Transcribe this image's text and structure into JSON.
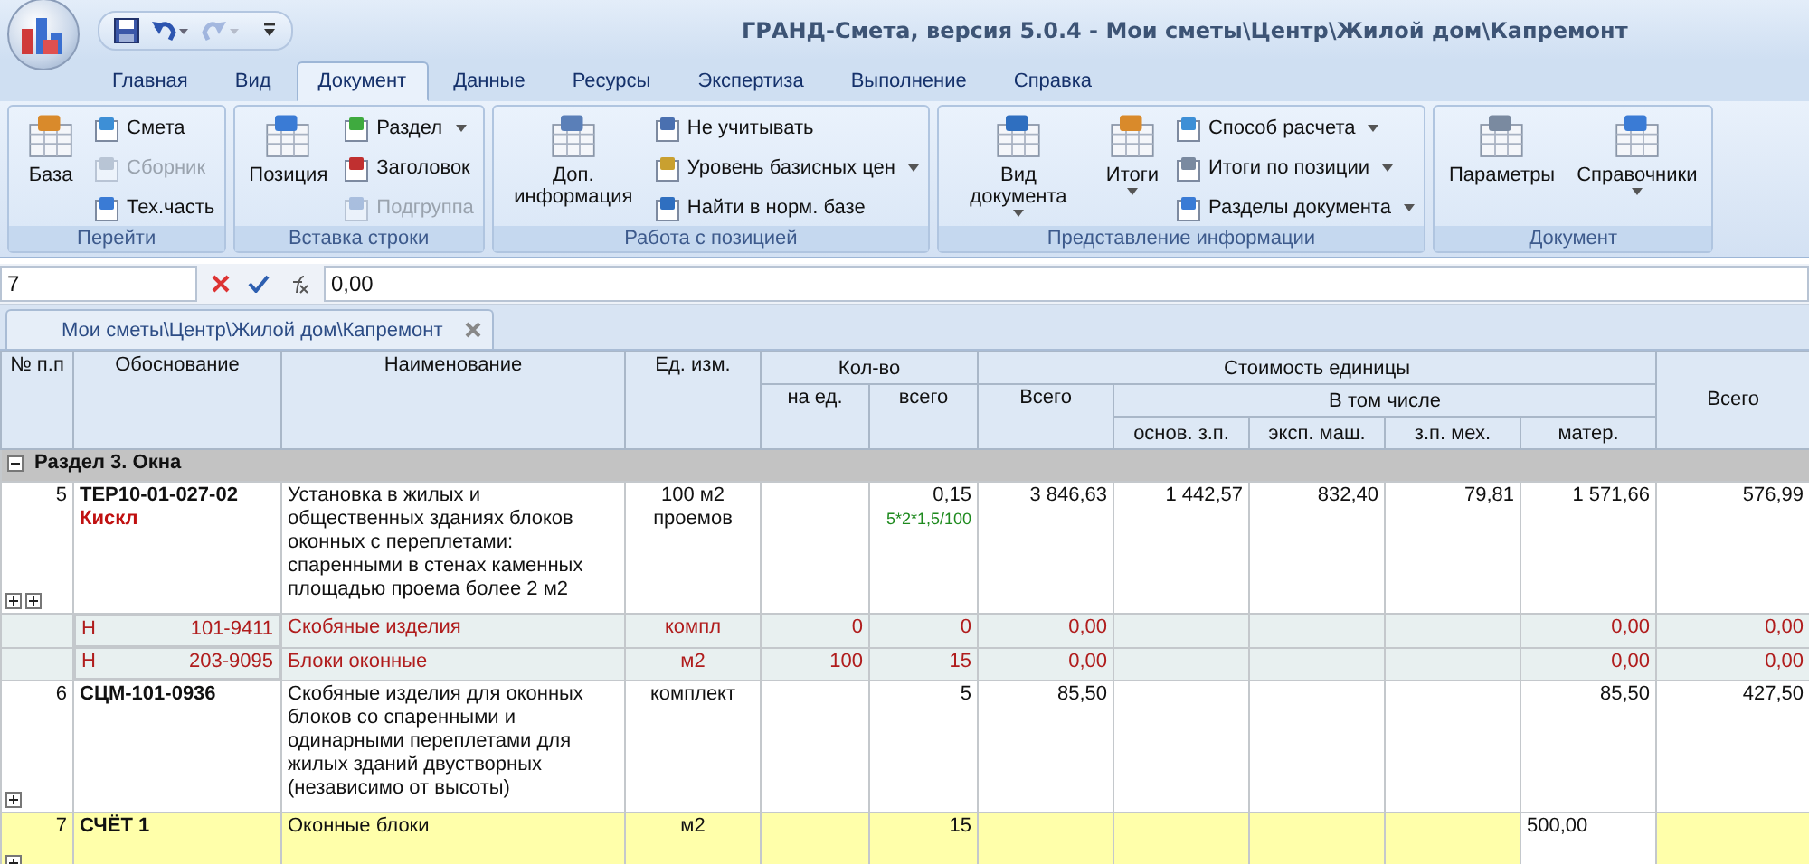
{
  "window": {
    "title": "ГРАНД-Смета, версия 5.0.4 - Мои сметы\\Центр\\Жилой дом\\Капремонт"
  },
  "menu_tabs": [
    {
      "label": "Главная",
      "selected": false
    },
    {
      "label": "Вид",
      "selected": false
    },
    {
      "label": "Документ",
      "selected": true
    },
    {
      "label": "Данные",
      "selected": false
    },
    {
      "label": "Ресурсы",
      "selected": false
    },
    {
      "label": "Экспертиза",
      "selected": false
    },
    {
      "label": "Выполнение",
      "selected": false
    },
    {
      "label": "Справка",
      "selected": false
    }
  ],
  "ribbon_groups": [
    {
      "label": "Перейти",
      "items": [
        {
          "kind": "large",
          "label": "База",
          "disabled": false,
          "dropdown": false
        },
        {
          "kind": "small",
          "label": "Смета",
          "disabled": false,
          "dropdown": false
        },
        {
          "kind": "small",
          "label": "Сборник",
          "disabled": true,
          "dropdown": false
        },
        {
          "kind": "small",
          "label": "Тех.часть",
          "disabled": false,
          "dropdown": false
        }
      ]
    },
    {
      "label": "Вставка строки",
      "items": [
        {
          "kind": "large",
          "label": "Позиция",
          "disabled": false,
          "dropdown": false
        },
        {
          "kind": "small",
          "label": "Раздел",
          "disabled": false,
          "dropdown": true
        },
        {
          "kind": "small",
          "label": "Заголовок",
          "disabled": false,
          "dropdown": false
        },
        {
          "kind": "small",
          "label": "Подгруппа",
          "disabled": true,
          "dropdown": false
        }
      ]
    },
    {
      "label": "Работа с позицией",
      "items": [
        {
          "kind": "large",
          "label": "Доп. информация",
          "disabled": false,
          "dropdown": false
        },
        {
          "kind": "small",
          "label": "Не учитывать",
          "disabled": false,
          "dropdown": false
        },
        {
          "kind": "small",
          "label": "Уровень базисных цен",
          "disabled": false,
          "dropdown": true
        },
        {
          "kind": "small",
          "label": "Найти в норм. базе",
          "disabled": false,
          "dropdown": false
        }
      ]
    },
    {
      "label": "Представление информации",
      "items": [
        {
          "kind": "large",
          "label": "Вид документа",
          "disabled": false,
          "dropdown": true
        },
        {
          "kind": "large",
          "label": "Итоги",
          "disabled": false,
          "dropdown": true
        },
        {
          "kind": "small",
          "label": "Способ расчета",
          "disabled": false,
          "dropdown": true
        },
        {
          "kind": "small",
          "label": "Итоги по позиции",
          "disabled": false,
          "dropdown": true
        },
        {
          "kind": "small",
          "label": "Разделы документа",
          "disabled": false,
          "dropdown": true
        }
      ]
    },
    {
      "label": "Документ",
      "items": [
        {
          "kind": "large",
          "label": "Параметры",
          "disabled": false,
          "dropdown": false
        },
        {
          "kind": "large",
          "label": "Справочники",
          "disabled": false,
          "dropdown": true
        }
      ]
    }
  ],
  "formula_bar": {
    "cell": "7",
    "value": "0,00"
  },
  "document_tab": {
    "label": "Мои сметы\\Центр\\Жилой дом\\Капремонт"
  },
  "table": {
    "headers": {
      "num": "№ п.п",
      "basis": "Обоснование",
      "name": "Наименование",
      "unit": "Ед. изм.",
      "qty": "Кол-во",
      "qty_per": "на ед.",
      "qty_total": "всего",
      "unit_cost": "Стоимость единицы",
      "cost_total": "Всего",
      "including": "В том числе",
      "base_wage": "основ. з.п.",
      "machine": "эксп. маш.",
      "mech_wage": "з.п. мех.",
      "material": "матер.",
      "total": "Всего"
    },
    "rows": [
      {
        "kind": "section",
        "label": "Раздел 3. Окна",
        "expanded": true
      },
      {
        "kind": "position",
        "num": "5",
        "code": "ТЕР10-01-027-02",
        "code_note": "Кискл",
        "name": "Установка в жилых и общественных зданиях блоков оконных с переплетами: спаренными в стенах каменных площадью проема более 2 м2",
        "unit": "100 м2 проемов",
        "qty_total": "0,15",
        "formula": "5*2*1,5/100",
        "cost_total": "3 846,63",
        "base_wage": "1 442,57",
        "machine": "832,40",
        "mech_wage": "79,81",
        "material": "1 571,66",
        "total": "576,99",
        "toggles": [
          {
            "expanded": false
          },
          {
            "expanded": false
          }
        ]
      },
      {
        "kind": "resource",
        "type": "Н",
        "code": "101-9411",
        "name": "Скобяные изделия",
        "unit": "компл",
        "qty_per": "0",
        "qty_total": "0",
        "cost_total": "0,00",
        "material": "0,00",
        "total": "0,00"
      },
      {
        "kind": "resource",
        "type": "Н",
        "code": "203-9095",
        "name": "Блоки оконные",
        "unit": "м2",
        "qty_per": "100",
        "qty_total": "15",
        "cost_total": "0,00",
        "material": "0,00",
        "total": "0,00"
      },
      {
        "kind": "position",
        "num": "6",
        "code": "СЦМ-101-0936",
        "name": "Скобяные изделия для оконных блоков со спаренными и одинарными переплетами для жилых зданий двустворных (независимо от высоты)",
        "unit": "комплект",
        "qty_total": "5",
        "cost_total": "85,50",
        "material": "85,50",
        "total": "427,50",
        "toggles": [
          {
            "expanded": false
          }
        ]
      },
      {
        "kind": "account",
        "num": "7",
        "code": "СЧЁТ 1",
        "name": "Оконные блоки",
        "unit": "м2",
        "qty_total": "15",
        "material": "500,00",
        "material_selected": true,
        "toggles": [
          {
            "expanded": false
          }
        ]
      }
    ]
  }
}
